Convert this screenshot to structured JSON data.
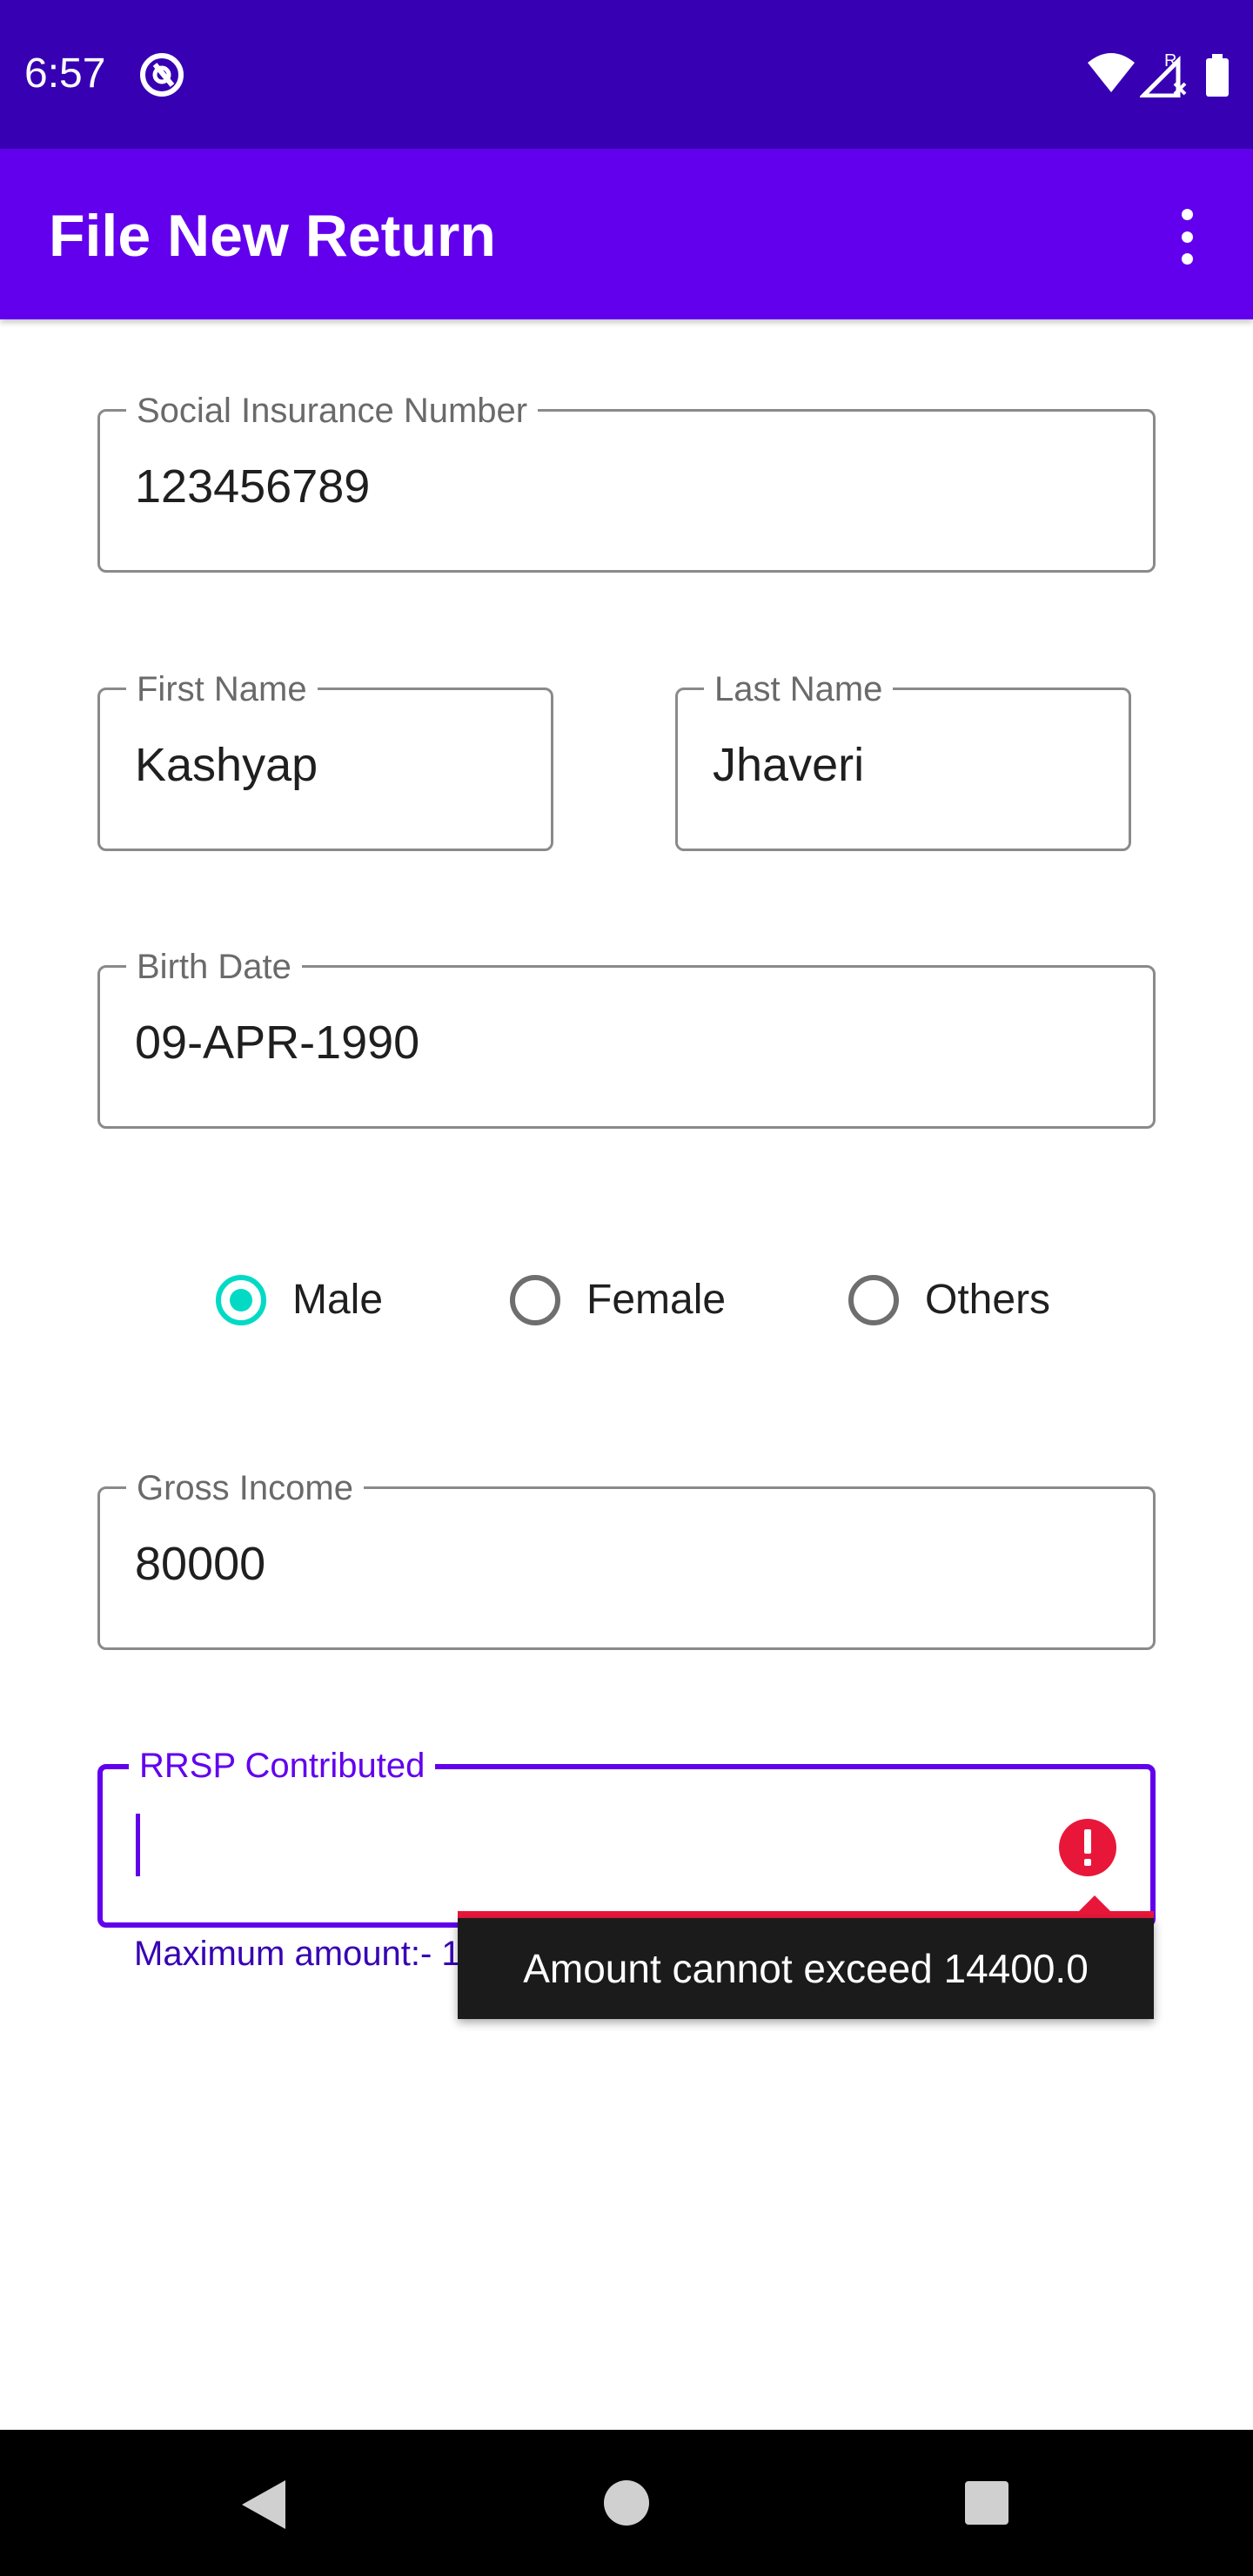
{
  "status_bar": {
    "time": "6:57",
    "icons": [
      "app-notification-icon",
      "wifi-icon",
      "signal-icon",
      "battery-icon"
    ]
  },
  "app_bar": {
    "title": "File New Return",
    "menu_icon": "overflow-menu-icon"
  },
  "form": {
    "sin": {
      "label": "Social Insurance Number",
      "value": "123456789"
    },
    "first_name": {
      "label": "First Name",
      "value": "Kashyap"
    },
    "last_name": {
      "label": "Last Name",
      "value": "Jhaveri"
    },
    "birth_date": {
      "label": "Birth Date",
      "value": "09-APR-1990"
    },
    "gender": {
      "options": [
        "Male",
        "Female",
        "Others"
      ],
      "selected": "Male"
    },
    "gross_income": {
      "label": "Gross Income",
      "value": "80000"
    },
    "rrsp": {
      "label": "RRSP Contributed",
      "value": "",
      "helper": "Maximum amount:- 14400.0",
      "error": "Amount cannot exceed 14400.0"
    }
  },
  "colors": {
    "status_bar": "#3700b3",
    "app_bar": "#6200ee",
    "radio_checked": "#03dac5",
    "error": "#e8173a"
  },
  "nav_bar": {
    "icons": [
      "back-icon",
      "home-icon",
      "recents-icon"
    ]
  }
}
